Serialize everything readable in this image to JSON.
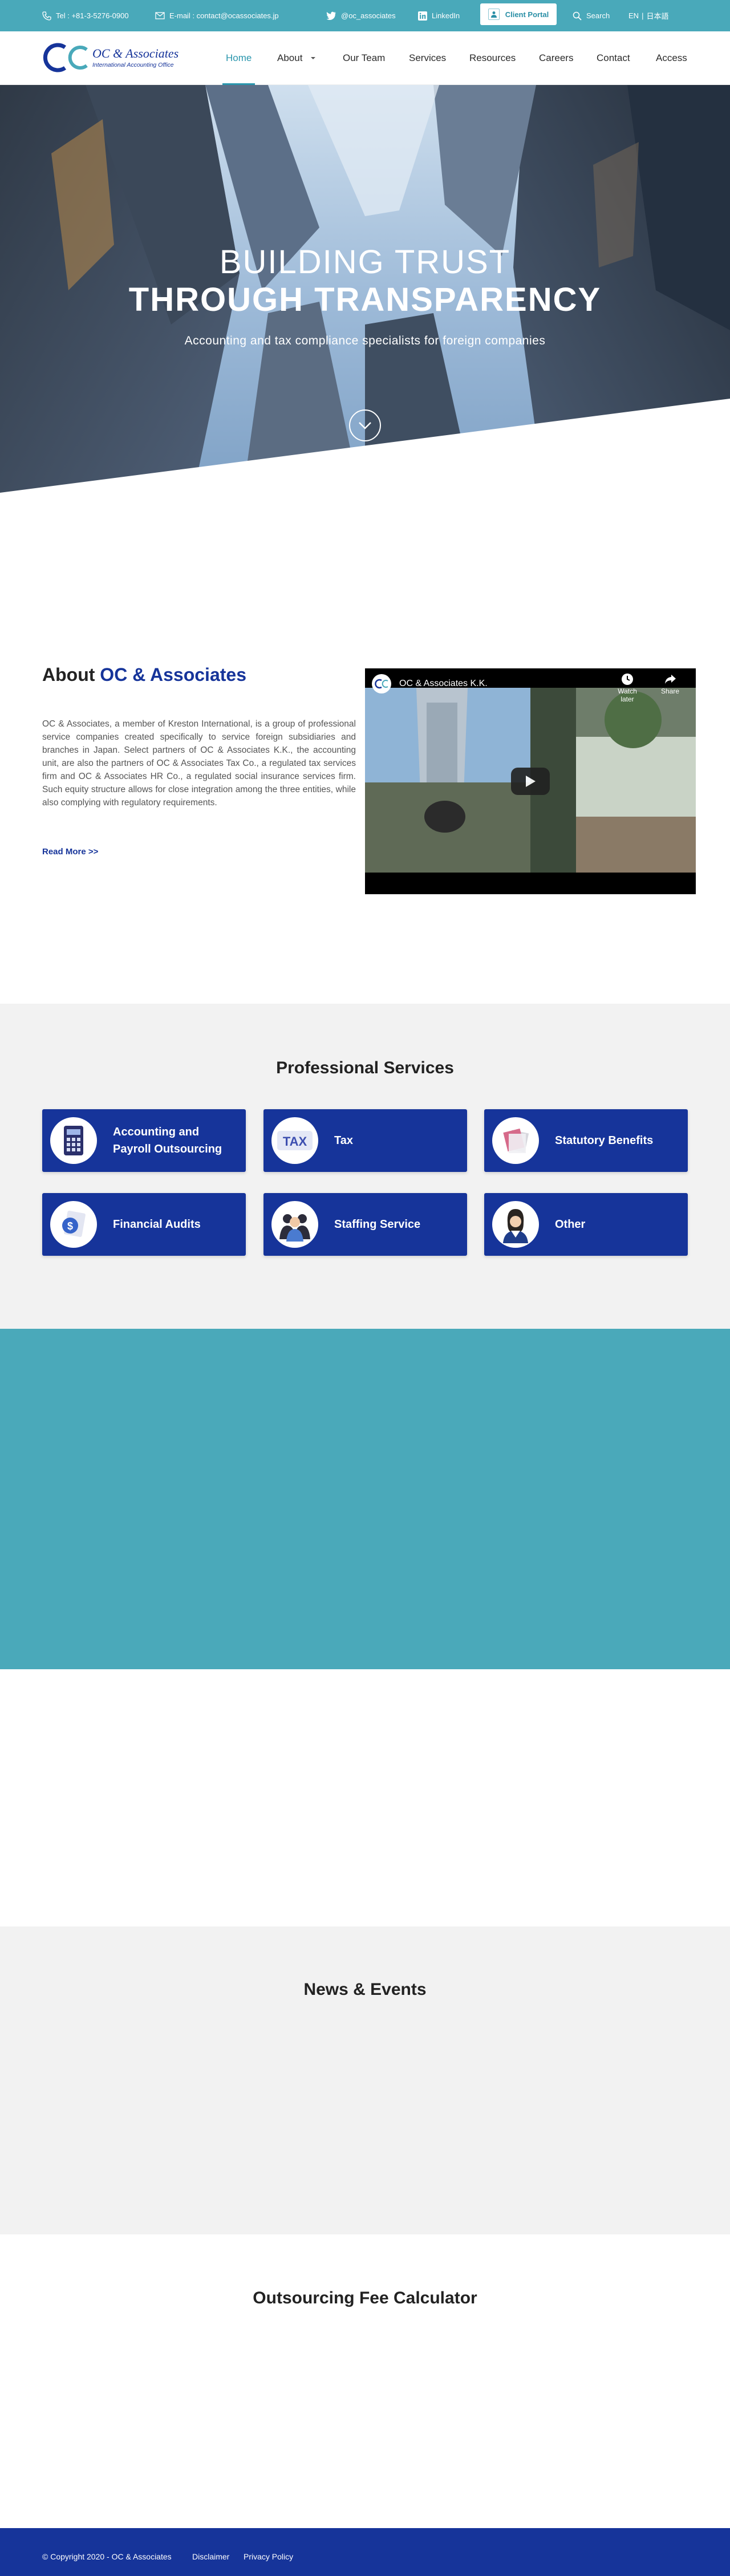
{
  "topbar": {
    "tel": "Tel : +81-3-5276-0900",
    "email": "E-mail : contact@ocassociates.jp",
    "twitter": "@oc_associates",
    "linkedin": "LinkedIn",
    "client_portal": "Client Portal",
    "search": "Search",
    "lang_en": "EN",
    "lang_divider": "|",
    "lang_jp": "日本語"
  },
  "logo": {
    "mark": "OC",
    "name": "OC & Associates",
    "tagline": "International Accounting Office"
  },
  "nav": {
    "home": "Home",
    "about": "About",
    "team": "Our Team",
    "services": "Services",
    "resources": "Resources",
    "careers": "Careers",
    "contact": "Contact",
    "access": "Access"
  },
  "hero": {
    "line1": "BUILDING TRUST",
    "line2": "THROUGH TRANSPARENCY",
    "subtitle": "Accounting and tax compliance specialists for foreign companies"
  },
  "about": {
    "title_prefix": "About ",
    "title_brand": "OC & Associates",
    "text": "OC & Associates, a member of Kreston International, is a group of professional service companies created specifically to service foreign subsidiaries and branches in Japan. Select partners of OC & Associates K.K., the accounting unit, are also the partners of OC & Associates Tax Co., a regulated tax services firm and OC & Associates HR Co., a regulated social insurance services firm. Such equity structure allows for close integration among the three entities, while also complying with regulatory requirements.",
    "read_more": "Read More >>",
    "video": {
      "title": "OC & Associates K.K.",
      "watch_later": "Watch later",
      "share": "Share"
    }
  },
  "services": {
    "title": "Professional Services",
    "items": [
      {
        "label": "Accounting and\nPayroll Outsourcing",
        "icon": "calculator-icon"
      },
      {
        "label": "Tax",
        "icon": "tax-icon",
        "icon_text": "TAX"
      },
      {
        "label": "Statutory Benefits",
        "icon": "documents-icon"
      },
      {
        "label": "Financial Audits",
        "icon": "audit-icon"
      },
      {
        "label": "Staffing Service",
        "icon": "staff-icon"
      },
      {
        "label": "Other",
        "icon": "person-icon"
      }
    ]
  },
  "news": {
    "title": "News & Events"
  },
  "calculator": {
    "title": "Outsourcing Fee Calculator"
  },
  "footer": {
    "copyright": "© Copyright 2020 - OC & Associates",
    "disclaimer": "Disclaimer",
    "privacy": "Privacy Policy"
  },
  "colors": {
    "teal": "#49a9ba",
    "navy": "#16349a",
    "accent": "#2a96ad"
  }
}
